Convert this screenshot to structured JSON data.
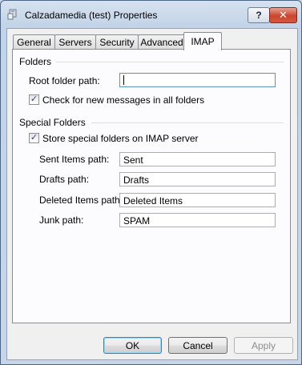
{
  "window": {
    "title": "Calzadamedia (test) Properties",
    "help_glyph": "?",
    "close_glyph": "✕"
  },
  "tabs": [
    {
      "label": "General"
    },
    {
      "label": "Servers"
    },
    {
      "label": "Security"
    },
    {
      "label": "Advanced"
    },
    {
      "label": "IMAP",
      "active": true
    }
  ],
  "folders": {
    "group_label": "Folders",
    "root_label": "Root folder path:",
    "root_value": "",
    "check_new_label": "Check for new messages in all folders",
    "check_new_checked": true
  },
  "special": {
    "group_label": "Special Folders",
    "store_label": "Store special folders on IMAP server",
    "store_checked": true,
    "sent_label": "Sent Items path:",
    "sent_value": "Sent",
    "drafts_label": "Drafts path:",
    "drafts_value": "Drafts",
    "deleted_label": "Deleted Items path:",
    "deleted_value": "Deleted Items",
    "junk_label": "Junk path:",
    "junk_value": "SPAM"
  },
  "buttons": {
    "ok": "OK",
    "cancel": "Cancel",
    "apply": "Apply"
  },
  "colors": {
    "check_mark": "#2b4a7a",
    "close_button": "#c9452e",
    "default_button_border": "#3c7fb1"
  },
  "icons": {
    "title": "account-icon",
    "check": "checkmark"
  }
}
